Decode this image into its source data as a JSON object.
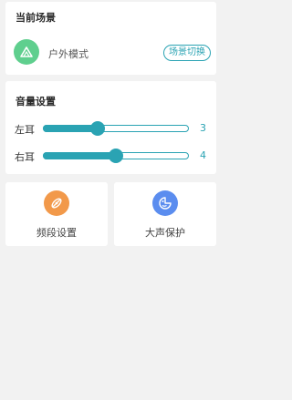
{
  "scene": {
    "title": "当前场景",
    "mode_name": "户外模式",
    "mode_icon": "mountain-icon",
    "switch_label": "场景切换"
  },
  "volume": {
    "title": "音量设置",
    "left": {
      "label": "左耳",
      "value": "3",
      "fraction": 0.375
    },
    "right": {
      "label": "右耳",
      "value": "4",
      "fraction": 0.5
    }
  },
  "tiles": [
    {
      "label": "频段设置",
      "icon": "frequency-band-icon",
      "color": "#f2994a"
    },
    {
      "label": "大声保护",
      "icon": "loud-protection-icon",
      "color": "#5b8def"
    }
  ],
  "colors": {
    "accent": "#2aa3b3",
    "scene_icon_bg": "#5fcf8e",
    "background": "#f2f2f2"
  }
}
